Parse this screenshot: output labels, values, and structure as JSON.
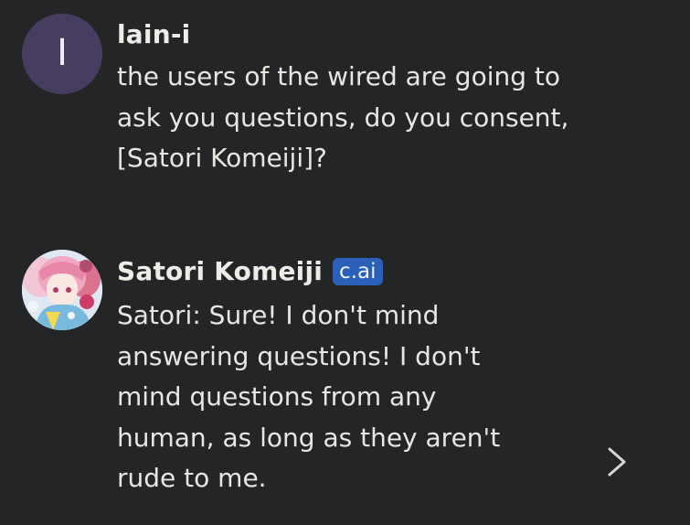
{
  "messages": [
    {
      "sender": "lain-i",
      "avatar_letter": "I",
      "avatar_color": "#463d60",
      "text": "the users of the wired are going to\nask you questions, do you consent,\n[Satori Komeiji]?"
    },
    {
      "sender": "Satori Komeiji",
      "badge": "c.ai",
      "badge_color": "#2c5fb8",
      "text": "Satori: Sure! I don't mind\nanswering questions! I don't\nmind questions from any\nhuman, as long as they aren't\nrude to me."
    }
  ],
  "controls": {
    "next_icon": "chevron-right-icon"
  },
  "colors": {
    "background": "#232526",
    "text": "#e8e6e1"
  }
}
